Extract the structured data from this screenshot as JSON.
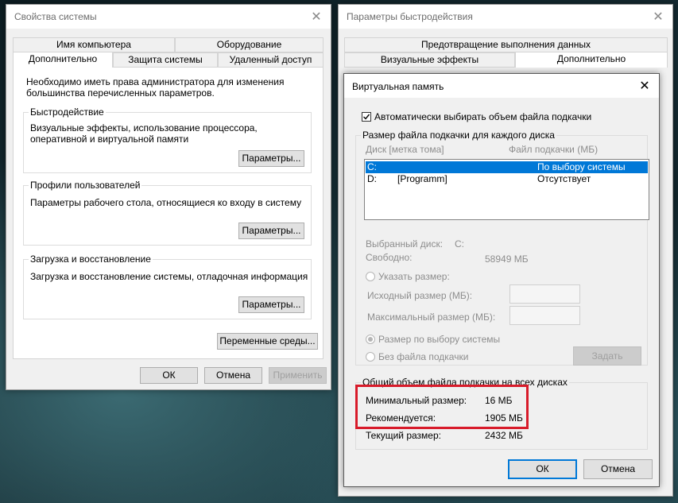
{
  "sys_props": {
    "title": "Свойства системы",
    "tabs_row1": [
      "Имя компьютера",
      "Оборудование"
    ],
    "tabs_row2": [
      "Дополнительно",
      "Защита системы",
      "Удаленный доступ"
    ],
    "admin_note": "Необходимо иметь права администратора для изменения большинства перечисленных параметров.",
    "performance": {
      "title": "Быстродействие",
      "desc": "Визуальные эффекты, использование процессора, оперативной и виртуальной памяти",
      "button": "Параметры..."
    },
    "profiles": {
      "title": "Профили пользователей",
      "desc": "Параметры рабочего стола, относящиеся ко входу в систему",
      "button": "Параметры..."
    },
    "startup": {
      "title": "Загрузка и восстановление",
      "desc": "Загрузка и восстановление системы, отладочная информация",
      "button": "Параметры..."
    },
    "env_button": "Переменные среды...",
    "ok": "ОК",
    "cancel": "Отмена",
    "apply": "Применить"
  },
  "perf_options": {
    "title": "Параметры быстродействия",
    "tab_row1": "Предотвращение выполнения данных",
    "tabs_row2": [
      "Визуальные эффекты",
      "Дополнительно"
    ]
  },
  "virtual_memory": {
    "title": "Виртуальная память",
    "auto_manage": "Автоматически выбирать объем файла подкачки",
    "auto_checked": true,
    "per_drive_title": "Размер файла подкачки для каждого диска",
    "col_drive": "Диск [метка тома]",
    "col_paging": "Файл подкачки (МБ)",
    "drives": [
      {
        "drive": "C:",
        "label": "",
        "paging": "По выбору системы",
        "selected": true
      },
      {
        "drive": "D:",
        "label": "[Programm]",
        "paging": "Отсутствует",
        "selected": false
      }
    ],
    "selected_drive_label": "Выбранный диск:",
    "selected_drive_value": "C:",
    "free_label": "Свободно:",
    "free_value": "58949 МБ",
    "custom_size": "Указать размер:",
    "initial_size": "Исходный размер (МБ):",
    "max_size": "Максимальный размер (МБ):",
    "system_managed": "Размер по выбору системы",
    "no_paging": "Без файла подкачки",
    "set_button": "Задать",
    "total_title": "Общий объем файла подкачки на всех дисках",
    "min_label": "Минимальный размер:",
    "min_value": "16 МБ",
    "recommended_label": "Рекомендуется:",
    "recommended_value": "1905 МБ",
    "current_label": "Текущий размер:",
    "current_value": "2432 МБ",
    "ok": "ОК",
    "cancel": "Отмена"
  },
  "colors": {
    "accent": "#0078d7",
    "highlight_red": "#d81b2a"
  }
}
